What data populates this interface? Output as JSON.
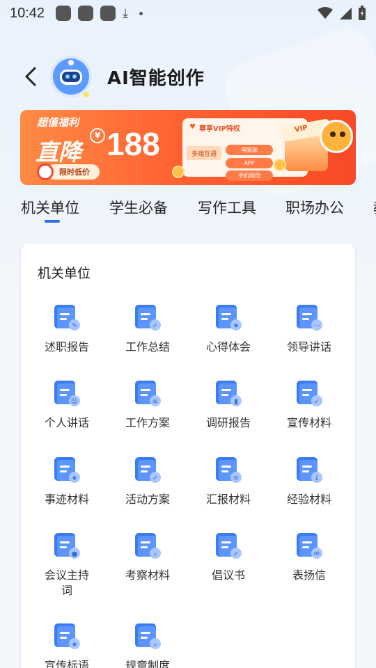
{
  "status_bar": {
    "time": "10:42"
  },
  "header": {
    "back": "back",
    "title": "AI智能创作"
  },
  "banner": {
    "tag": "超值福利",
    "headline": "直降",
    "currency": "¥",
    "price": "188",
    "pill": "限时低价",
    "card_title": "尊享VIP特权",
    "multi": "多端互通",
    "chips": [
      "电脑端",
      "APP",
      "手机网页"
    ],
    "vip": "VIP"
  },
  "tabs": [
    "机关单位",
    "学生必备",
    "写作工具",
    "职场办公",
    "教"
  ],
  "panel": {
    "title": "机关单位",
    "items": [
      {
        "label": "述职报告",
        "icon": "report-edit-icon"
      },
      {
        "label": "工作总结",
        "icon": "folder-check-icon"
      },
      {
        "label": "心得体会",
        "icon": "doc-star-icon"
      },
      {
        "label": "领导讲话",
        "icon": "doc-chat-icon"
      },
      {
        "label": "个人讲话",
        "icon": "person-chat-icon"
      },
      {
        "label": "工作方案",
        "icon": "folder-stack-icon"
      },
      {
        "label": "调研报告",
        "icon": "clipboard-chart-icon"
      },
      {
        "label": "宣传材料",
        "icon": "mail-check-icon"
      },
      {
        "label": "事迹材料",
        "icon": "folder-star-icon"
      },
      {
        "label": "活动方案",
        "icon": "clipboard-check-icon"
      },
      {
        "label": "汇报材料",
        "icon": "folder-layers-icon"
      },
      {
        "label": "经验材料",
        "icon": "folder-down-icon"
      },
      {
        "label": "会议主持词",
        "icon": "doc-mic-icon"
      },
      {
        "label": "考察材料",
        "icon": "doc-search-icon"
      },
      {
        "label": "倡议书",
        "icon": "doc-check-icon"
      },
      {
        "label": "表扬信",
        "icon": "envelope-icon"
      },
      {
        "label": "宣传标语",
        "icon": "bookmark-star-icon"
      },
      {
        "label": "规章制度",
        "icon": "doc-magnify-icon"
      }
    ]
  },
  "colors": {
    "accent": "#2f6ee8",
    "icon_blue": "#3b7cf2",
    "icon_light": "#a9c7ff",
    "banner": "#ff6331"
  }
}
